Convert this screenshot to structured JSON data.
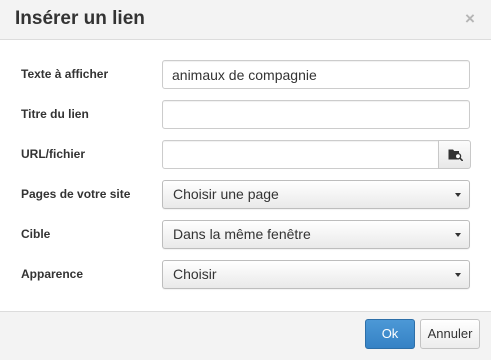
{
  "dialog": {
    "title": "Insérer un lien",
    "close_glyph": "×",
    "close_icon": "close-icon"
  },
  "fields": {
    "text": {
      "label": "Texte à afficher",
      "value": "animaux de compagnie",
      "placeholder": ""
    },
    "title": {
      "label": "Titre du lien",
      "value": "",
      "placeholder": ""
    },
    "url": {
      "label": "URL/fichier",
      "value": "",
      "placeholder": "",
      "browse_icon": "folder-search-icon"
    },
    "pages": {
      "label": "Pages de votre site",
      "selected": "Choisir une page"
    },
    "target": {
      "label": "Cible",
      "selected": "Dans la même fenêtre"
    },
    "appearance": {
      "label": "Apparence",
      "selected": "Choisir"
    }
  },
  "buttons": {
    "ok": "Ok",
    "cancel": "Annuler"
  },
  "colors": {
    "header_bg": "#f3f3f3",
    "primary_button": "#3f8ccd",
    "border": "#cccccc"
  }
}
